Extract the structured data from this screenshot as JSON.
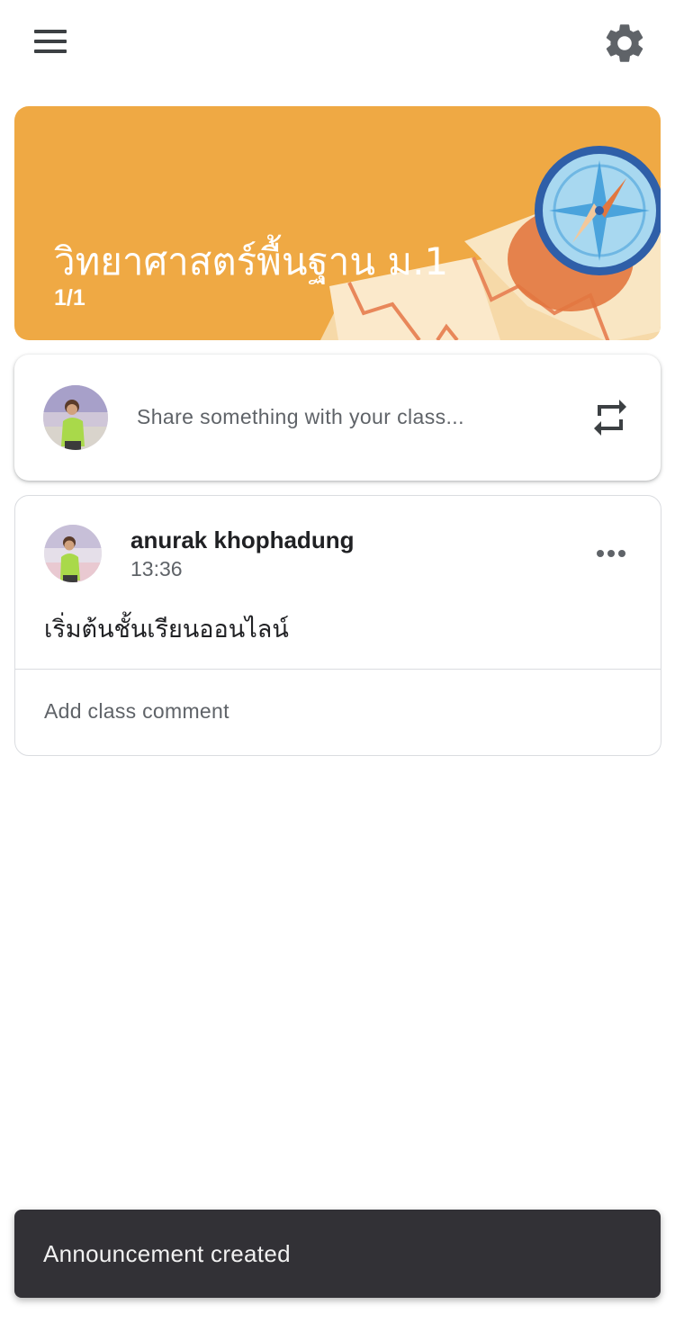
{
  "topbar": {
    "menu_icon": "hamburger-menu-icon",
    "settings_icon": "gear-icon"
  },
  "banner": {
    "title": "วิทยาศาสตร์พื้นฐาน ม.1",
    "section": "1/1",
    "background_color": "#efa944",
    "illustration": "map-and-compass-illustration"
  },
  "share": {
    "placeholder": "Share something with your class...",
    "repost_icon": "repost-icon"
  },
  "post": {
    "author": "anurak khophadung",
    "time": "13:36",
    "text": "เริ่มต้นชั้นเรียนออนไลน์",
    "more_icon": "more-horizontal-icon",
    "comment_placeholder": "Add class comment"
  },
  "snackbar": {
    "message": "Announcement created"
  }
}
